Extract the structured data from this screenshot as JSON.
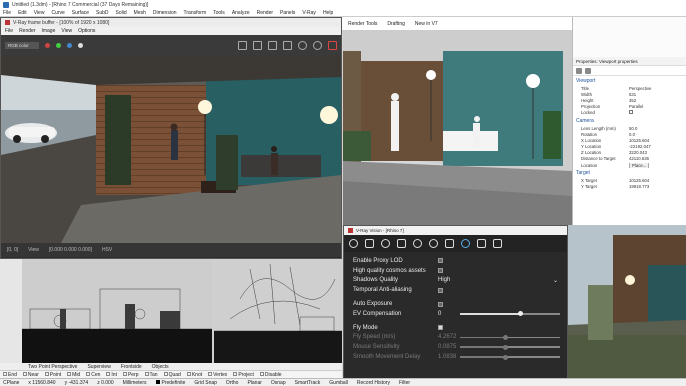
{
  "app_title": "Untitled (1.3dm) - [Rhino 7 Commercial (37 Days Remaining)]",
  "menu": [
    "File",
    "Edit",
    "View",
    "Curve",
    "Surface",
    "SubD",
    "Solid",
    "Mesh",
    "Dimension",
    "Transform",
    "Tools",
    "Analyze",
    "Render",
    "Panels",
    "V-Ray",
    "Help"
  ],
  "vfb": {
    "title": "V-Ray frame buffer - [100% of 1920 x 1080]",
    "menu": [
      "File",
      "Render",
      "Image",
      "View",
      "Options"
    ],
    "channel": "RGB color",
    "status_left": "[0, 0]",
    "status_mid": "[0.000 0.000 0.000]",
    "status_view": "View",
    "status_hsv": "HSV"
  },
  "rtop_tabs": [
    "Render Tools",
    "Drafting",
    "New in V7"
  ],
  "props": {
    "header": "Properties: Viewport properties",
    "viewport_section": "Viewport",
    "viewport_rows": [
      {
        "k": "Title",
        "v": "Perspective"
      },
      {
        "k": "Width",
        "v": "531"
      },
      {
        "k": "Height",
        "v": "352"
      },
      {
        "k": "Projection",
        "v": "Parallel"
      },
      {
        "k": "Locked",
        "v": ""
      }
    ],
    "camera_section": "Camera",
    "camera_rows": [
      {
        "k": "Lens Length (mm)",
        "v": "50.0"
      },
      {
        "k": "Rotation",
        "v": "0.0"
      },
      {
        "k": "X Location",
        "v": "10125.604"
      },
      {
        "k": "Y Location",
        "v": "-22192.047"
      },
      {
        "k": "Z Location",
        "v": "3220.043"
      },
      {
        "k": "Distance to Target",
        "v": "42110.636"
      },
      {
        "k": "Location",
        "v": "Place..."
      }
    ],
    "target_section": "Target",
    "target_rows": [
      {
        "k": "X Target",
        "v": "10125.604"
      },
      {
        "k": "Y Target",
        "v": "19918.773"
      }
    ]
  },
  "vision": {
    "title": "V-Ray Vision - [Rhino 7]",
    "settings": [
      {
        "label": "Enable Proxy LOD",
        "type": "check",
        "checked": true,
        "dim": false
      },
      {
        "label": "High quality cosmos assets",
        "type": "check",
        "checked": true,
        "dim": false
      },
      {
        "label": "Shadows Quality",
        "type": "select",
        "value": "High",
        "dim": false
      },
      {
        "label": "Temporal Anti-aliasing",
        "type": "check",
        "checked": true,
        "dim": false
      },
      {
        "label": "Auto Exposure",
        "type": "check",
        "checked": true,
        "dim": false
      },
      {
        "label": "EV Compensation",
        "type": "slider",
        "value": "0",
        "level": 0.6,
        "dim": false
      },
      {
        "label": "Fly Mode",
        "type": "check",
        "checked": false,
        "dim": false
      },
      {
        "label": "Fly Speed (m/s)",
        "type": "slider",
        "value": "4.2672",
        "level": 0.45,
        "dim": true
      },
      {
        "label": "Mouse Sensitivity",
        "type": "slider",
        "value": "0.0875",
        "level": 0.45,
        "dim": true
      },
      {
        "label": "Smooth Movement Delay",
        "type": "slider",
        "value": "1.0838",
        "level": 0.45,
        "dim": true
      }
    ],
    "shadow_arrow": "⌄"
  },
  "viewport_labels": [
    "Two Point Perspective",
    "Superview",
    "Frontside",
    "Objects"
  ],
  "osnaps": [
    "End",
    "Near",
    "Point",
    "Mid",
    "Cen",
    "Int",
    "Perp",
    "Tan",
    "Quad",
    "Knot",
    "Vertex",
    "Project",
    "Disable"
  ],
  "status": {
    "cplane": "CPlane",
    "x": "x 11560.840",
    "y": "y -431.374",
    "z": "z 0.000",
    "units": "Millimeters",
    "layer": "Predefinite",
    "toggles": [
      "Grid Snap",
      "Ortho",
      "Planar",
      "Osnap",
      "SmartTrack",
      "Gumball",
      "Record History",
      "Filter"
    ]
  }
}
